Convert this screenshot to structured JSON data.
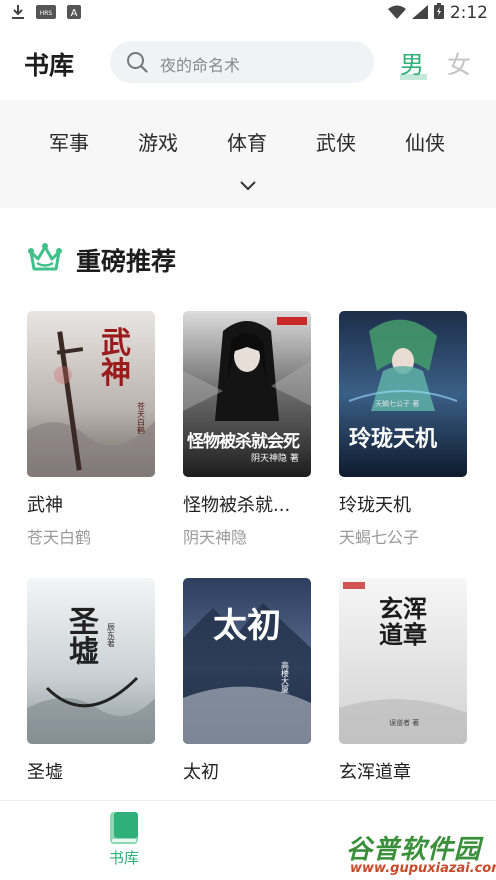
{
  "status_bar": {
    "time": "2:12",
    "icons": [
      "download-icon",
      "hd-icon",
      "font-a-icon",
      "wifi-icon",
      "signal-icon",
      "battery-icon"
    ],
    "left_labels": {
      "hd": "HRS",
      "font": "A"
    }
  },
  "header": {
    "title": "书库",
    "search_placeholder": "夜的命名术",
    "gender_male": "男",
    "gender_female": "女",
    "accent_color": "#2fb07a"
  },
  "categories": [
    "军事",
    "游戏",
    "体育",
    "武侠",
    "仙侠"
  ],
  "section": {
    "title": "重磅推荐",
    "icon": "crown-icon"
  },
  "books": [
    {
      "title": "武神",
      "author": "苍天白鹤",
      "cover_text": "武神",
      "cover_sub": "苍天白鹤"
    },
    {
      "title": "怪物被杀就...",
      "author": "阴天神隐",
      "cover_text": "怪物被杀就会死",
      "cover_sub": "阴天神隐 著"
    },
    {
      "title": "玲珑天机",
      "author": "天蝎七公子",
      "cover_text": "玲珑天机",
      "cover_sub": "天蝎七公子 著"
    },
    {
      "title": "圣墟",
      "author": "辰东",
      "cover_text": "圣墟",
      "cover_sub": "辰东 著"
    },
    {
      "title": "太初",
      "author": "高楼大厦",
      "cover_text": "太初",
      "cover_sub": "高楼大厦"
    },
    {
      "title": "玄浑道章",
      "author": "误道者",
      "cover_text": "玄浑道章",
      "cover_sub": "误道者 著"
    }
  ],
  "bottom_nav": {
    "items": [
      {
        "label": "书库",
        "icon": "book-icon",
        "active": true
      }
    ]
  },
  "watermark": {
    "text": "谷普软件园",
    "url": "www.gupuxiazai.com"
  }
}
